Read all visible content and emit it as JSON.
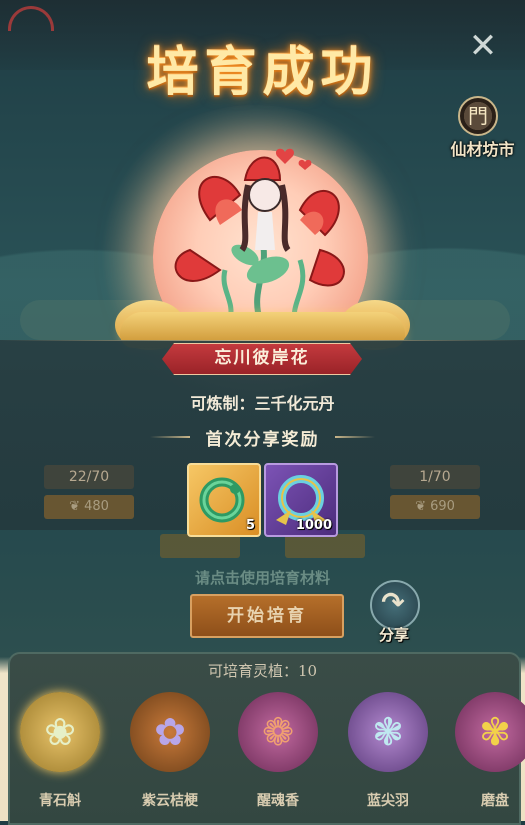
{
  "popup": {
    "title": "培育成功",
    "flower_name": "忘川彼岸花",
    "refine_text": "可炼制：三千化元丹",
    "reward_title": "首次分享奖励",
    "rewards": [
      {
        "icon": "jade-dragon-ring-icon",
        "count": "5",
        "rarity_color": "#e8a23a"
      },
      {
        "icon": "spirit-ring-icon",
        "count": "1000",
        "rarity_color": "#6a3f9c"
      }
    ]
  },
  "header": {
    "shop_label": "仙材坊市"
  },
  "background_screen": {
    "left_card": {
      "progress": "22/70",
      "cost": "480"
    },
    "right_card": {
      "progress": "1/70",
      "cost": "690"
    },
    "hint": "请点击使用培育材料",
    "start_button": "开始培育",
    "share_label": "分享"
  },
  "plant_list": {
    "label": "可培育灵植：10",
    "items": [
      {
        "name": "青石斛",
        "color": "#c9a24a"
      },
      {
        "name": "紫云桔梗",
        "color": "#8a5b2e"
      },
      {
        "name": "醒魂香",
        "color": "#8a4a6e"
      },
      {
        "name": "蓝尖羽",
        "color": "#7a5a8e"
      },
      {
        "name": "磨盘",
        "color": "#8a4a6e"
      }
    ]
  }
}
